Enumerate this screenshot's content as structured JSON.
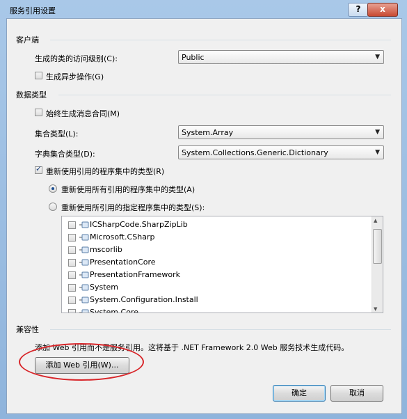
{
  "window": {
    "title": "服务引用设置",
    "help_label": "?",
    "close_label": "x"
  },
  "client": {
    "group_title": "客户端",
    "access_level_label": "生成的类的访问级别(C):",
    "access_level_value": "Public",
    "async_label": "生成异步操作(G)",
    "async_checked": false
  },
  "data_type": {
    "group_title": "数据类型",
    "always_generate_label": "始终生成消息合同(M)",
    "always_generate_checked": false,
    "collection_type_label": "集合类型(L):",
    "collection_type_value": "System.Array",
    "dictionary_type_label": "字典集合类型(D):",
    "dictionary_type_value": "System.Collections.Generic.Dictionary",
    "reuse_types_label": "重新使用引用的程序集中的类型(R)",
    "reuse_types_checked": true,
    "reuse_all_label": "重新使用所有引用的程序集中的类型(A)",
    "reuse_all_selected": true,
    "reuse_specified_label": "重新使用所引用的指定程序集中的类型(S):",
    "reuse_specified_selected": false,
    "assemblies": [
      "ICSharpCode.SharpZipLib",
      "Microsoft.CSharp",
      "mscorlib",
      "PresentationCore",
      "PresentationFramework",
      "System",
      "System.Configuration.Install",
      "System.Core"
    ]
  },
  "compat": {
    "group_title": "兼容性",
    "description": "添加 Web 引用而不是服务引用。这将基于 .NET Framework 2.0 Web 服务技术生成代码。",
    "add_web_ref_label": "添加 Web 引用(W)..."
  },
  "footer": {
    "ok_label": "确定",
    "cancel_label": "取消"
  },
  "colors": {
    "annotation": "#d8262a",
    "title_bar": "#a9c8e8"
  }
}
